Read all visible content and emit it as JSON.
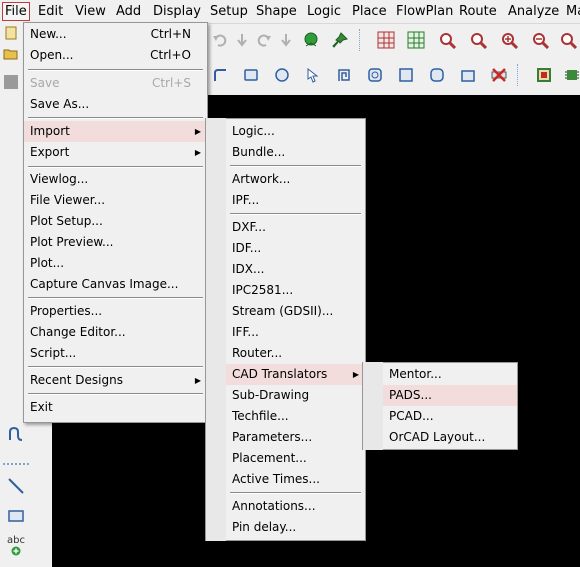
{
  "menubar": {
    "items": [
      "File",
      "Edit",
      "View",
      "Add",
      "Display",
      "Setup",
      "Shape",
      "Logic",
      "Place",
      "FlowPlan",
      "Route",
      "Analyze",
      "Ma"
    ]
  },
  "file_menu": {
    "new": {
      "label": "New...",
      "shortcut": "Ctrl+N"
    },
    "open": {
      "label": "Open...",
      "shortcut": "Ctrl+O"
    },
    "save": {
      "label": "Save",
      "shortcut": "Ctrl+S"
    },
    "save_as": "Save As...",
    "import": "Import",
    "export": "Export",
    "viewlog": "Viewlog...",
    "file_viewer": "File Viewer...",
    "plot_setup": "Plot Setup...",
    "plot_preview": "Plot Preview...",
    "plot": "Plot...",
    "capture": "Capture Canvas Image...",
    "properties": "Properties...",
    "change_editor": "Change Editor...",
    "script": "Script...",
    "recent_designs": "Recent Designs",
    "exit": "Exit"
  },
  "import_menu": {
    "logic": "Logic...",
    "bundle": "Bundle...",
    "artwork": "Artwork...",
    "ipf": "IPF...",
    "dxf": "DXF...",
    "idf": "IDF...",
    "idx": "IDX...",
    "ipc2581": "IPC2581...",
    "stream": "Stream (GDSII)...",
    "iff": "IFF...",
    "router": "Router...",
    "cad_translators": "CAD Translators",
    "sub_drawing": "Sub-Drawing",
    "techfile": "Techfile...",
    "parameters": "Parameters...",
    "placement": "Placement...",
    "active_times": "Active Times...",
    "annotations": "Annotations...",
    "pin_delay": "Pin delay..."
  },
  "cad_menu": {
    "mentor": "Mentor...",
    "pads": "PADS...",
    "pcad": "PCAD...",
    "orcad_layout": "OrCAD Layout..."
  },
  "left_toolbar": {
    "abc_label": "abc"
  },
  "colors": {
    "highlight": "#f2dcdc",
    "active_border": "#c23b3b",
    "canvas": "#000000"
  }
}
